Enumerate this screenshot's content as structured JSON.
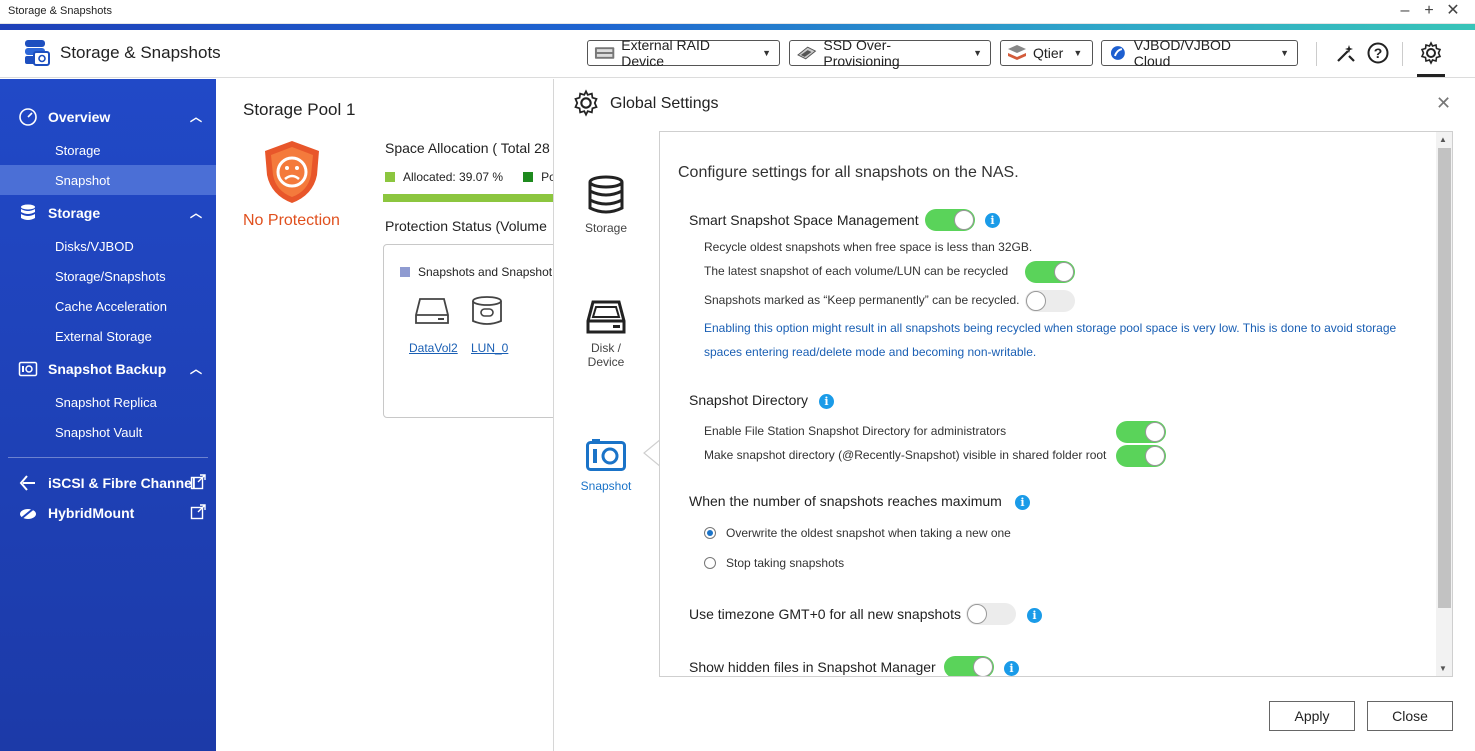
{
  "window": {
    "title": "Storage & Snapshots"
  },
  "header": {
    "app_title": "Storage & Snapshots",
    "buttons": [
      {
        "label": "External RAID Device"
      },
      {
        "label": "SSD Over-Provisioning"
      },
      {
        "label": "Qtier"
      },
      {
        "label": "VJBOD/VJBOD Cloud"
      }
    ]
  },
  "sidebar": {
    "sections": [
      {
        "label": "Overview",
        "items": [
          "Storage",
          "Snapshot"
        ]
      },
      {
        "label": "Storage",
        "items": [
          "Disks/VJBOD",
          "Storage/Snapshots",
          "Cache Acceleration",
          "External Storage"
        ]
      },
      {
        "label": "Snapshot Backup",
        "items": [
          "Snapshot Replica",
          "Snapshot Vault"
        ]
      }
    ],
    "links": [
      "iSCSI & Fibre Channel",
      "HybridMount"
    ]
  },
  "main": {
    "pool_title": "Storage Pool 1",
    "protection_label": "No Protection",
    "space_allocation": "Space Allocation ( Total 28",
    "allocated_legend": "Allocated: 39.07 %",
    "pool_legend": "Po",
    "protection_status": "Protection Status (Volume",
    "snap_legend": "Snapshots and Snapshot",
    "volumes": [
      "DataVol2",
      "LUN_0"
    ]
  },
  "dialog": {
    "title": "Global Settings",
    "nav": [
      "Storage",
      "Disk / Device",
      "Snapshot"
    ],
    "heading": "Configure settings for all snapshots on the NAS.",
    "smart": {
      "title": "Smart Snapshot Space Management",
      "recycle_text": "Recycle oldest snapshots when free space is less than 32GB.",
      "latest_text": "The latest snapshot of each volume/LUN can be recycled",
      "keep_text": "Snapshots marked as “Keep permanently” can be recycled.",
      "note": "Enabling this option might result in all snapshots being recycled when storage pool space is very low. This is done to avoid storage spaces entering read/delete mode and becoming non-writable."
    },
    "directory": {
      "title": "Snapshot Directory",
      "admin_text": "Enable File Station Snapshot Directory for administrators",
      "visible_text": "Make snapshot directory (@Recently-Snapshot) visible in shared folder root"
    },
    "maximum": {
      "title": "When the number of snapshots reaches maximum",
      "option1": "Overwrite the oldest snapshot when taking a new one",
      "option2": "Stop taking snapshots"
    },
    "timezone_text": "Use timezone GMT+0 for all new snapshots",
    "hidden_text": "Show hidden files in Snapshot Manager",
    "apply_label": "Apply",
    "close_label": "Close"
  },
  "colors": {
    "sidebar": "#1f44bd",
    "toggle_on": "#5ad35a",
    "info": "#1a9be8",
    "link": "#1a5fb4",
    "warning": "#e0501e"
  }
}
